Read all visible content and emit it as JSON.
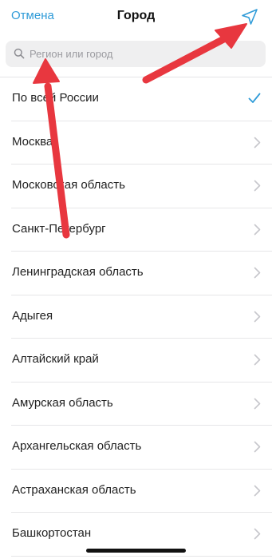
{
  "header": {
    "cancel_label": "Отмена",
    "title": "Город",
    "locate_icon": "location-arrow-icon"
  },
  "search": {
    "placeholder": "Регион или город",
    "value": "",
    "icon": "search-icon"
  },
  "list": {
    "items": [
      {
        "label": "По всей России",
        "icon": "checkmark-icon",
        "selected": true
      },
      {
        "label": "Москва",
        "icon": "chevron-right-icon",
        "selected": false
      },
      {
        "label": "Московская область",
        "icon": "chevron-right-icon",
        "selected": false
      },
      {
        "label": "Санкт-Петербург",
        "icon": "chevron-right-icon",
        "selected": false
      },
      {
        "label": "Ленинградская область",
        "icon": "chevron-right-icon",
        "selected": false
      },
      {
        "label": "Адыгея",
        "icon": "chevron-right-icon",
        "selected": false
      },
      {
        "label": "Алтайский край",
        "icon": "chevron-right-icon",
        "selected": false
      },
      {
        "label": "Амурская область",
        "icon": "chevron-right-icon",
        "selected": false
      },
      {
        "label": "Архангельская область",
        "icon": "chevron-right-icon",
        "selected": false
      },
      {
        "label": "Астраханская область",
        "icon": "chevron-right-icon",
        "selected": false
      },
      {
        "label": "Башкортостан",
        "icon": "chevron-right-icon",
        "selected": false
      }
    ]
  },
  "colors": {
    "accent": "#2f9bd8",
    "annotation_arrow": "#e8373f",
    "chevron": "#c7c7cc",
    "search_bg": "#efeff0"
  }
}
